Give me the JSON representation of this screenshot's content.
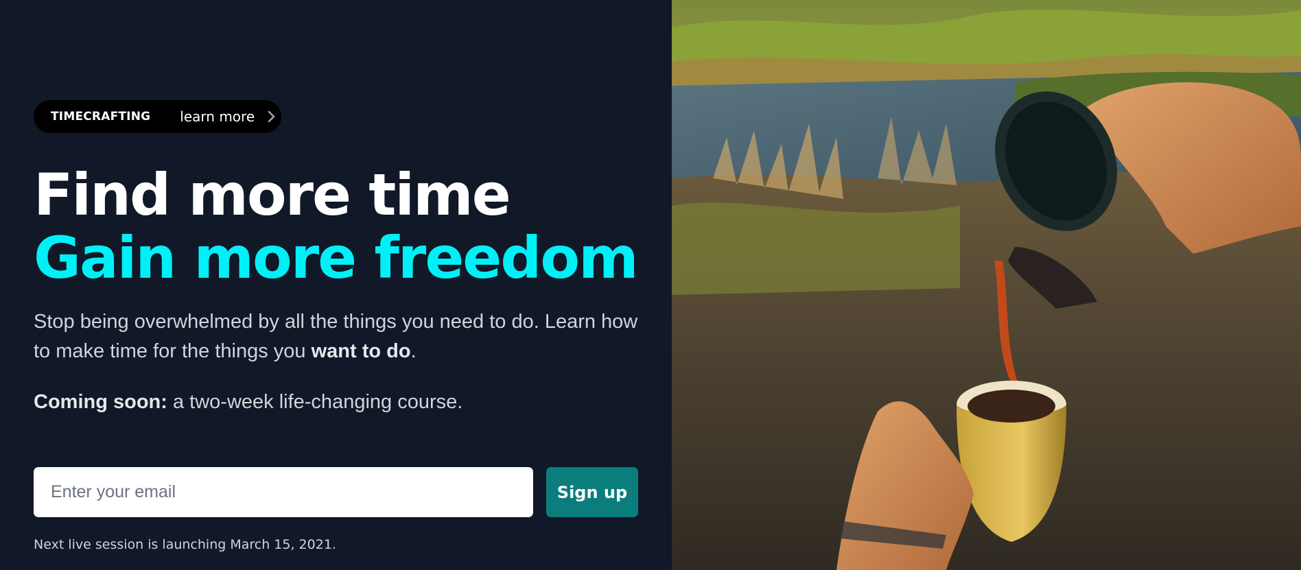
{
  "announcement": {
    "tag": "TIMECRAFTING",
    "link_label": "learn more",
    "chevron_icon": "chevron-right-icon"
  },
  "headline": {
    "line1": "Find more time",
    "line2": "Gain more freedom"
  },
  "description": {
    "text_before": "Stop being overwhelmed by all the things you need to do. Learn how to make time for the things you ",
    "emphasis": "want to do",
    "text_after": "."
  },
  "coming_soon": {
    "label": "Coming soon:",
    "text": " a two-week life-changing course."
  },
  "signup_form": {
    "email_placeholder": "Enter your email",
    "email_value": "",
    "button_label": "Sign up"
  },
  "footnote": "Next live session is launching March 15, 2021.",
  "colors": {
    "background": "#111827",
    "accent": "#00f0f8",
    "button": "#0b7d7d"
  },
  "hero_image": {
    "subject": "photo-coffee-pour-by-lake"
  }
}
